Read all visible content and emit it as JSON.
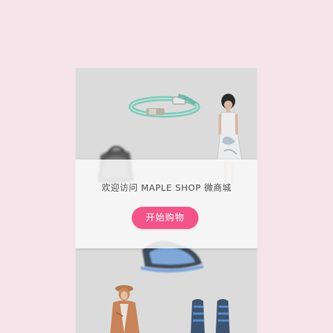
{
  "welcome": {
    "text": "欢迎访问 MAPLE SHOP 微商城",
    "button_label": "开始购物"
  },
  "colors": {
    "page_background": "#f5e4ea",
    "screen_background": "#dcdbdb",
    "accent": "#f2548a",
    "band_background": "#f8f8f8"
  },
  "products": [
    "bracelet-image",
    "dress-model-image",
    "bag-image",
    "shoes-image",
    "coat-model-image",
    "sandals-image"
  ]
}
